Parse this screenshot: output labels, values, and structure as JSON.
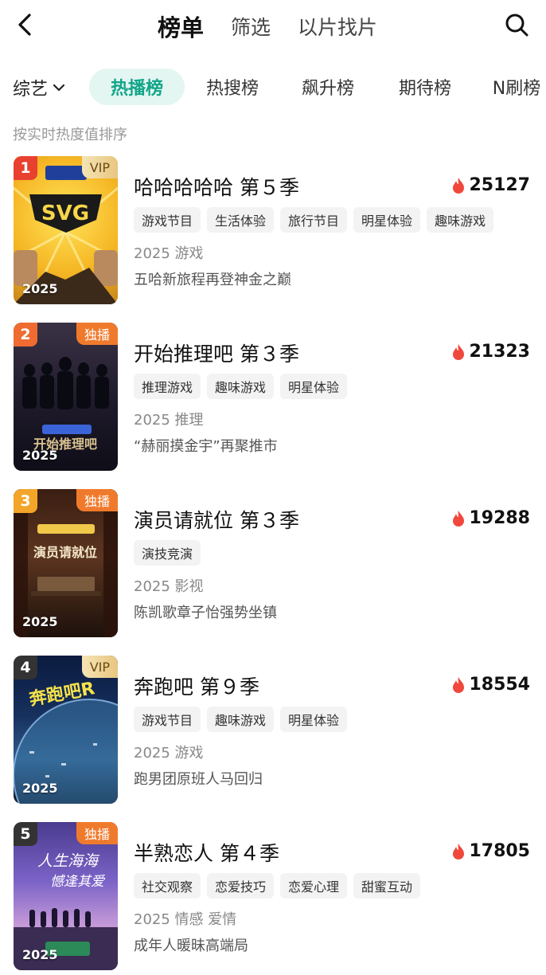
{
  "header": {
    "tabs": [
      "榜单",
      "筛选",
      "以片找片"
    ],
    "active_tab": "榜单"
  },
  "filter": {
    "category": "综艺",
    "chips": [
      "热播榜",
      "热搜榜",
      "飙升榜",
      "期待榜",
      "N刷榜"
    ],
    "active_chip": "热播榜"
  },
  "sort_hint": "按实时热度值排序",
  "items": [
    {
      "rank": "1",
      "badge": "VIP",
      "year_overlay": "2025",
      "title": "哈哈哈哈哈 第５季",
      "heat": "25127",
      "tags": [
        "游戏节目",
        "生活体验",
        "旅行节目",
        "明星体验",
        "趣味游戏"
      ],
      "meta": "2025 游戏",
      "desc": "五哈新旅程再登神金之巅"
    },
    {
      "rank": "2",
      "badge": "独播",
      "year_overlay": "2025",
      "title": "开始推理吧 第３季",
      "heat": "21323",
      "tags": [
        "推理游戏",
        "趣味游戏",
        "明星体验"
      ],
      "meta": "2025 推理",
      "desc": "“赫丽摸金宇”再聚推市"
    },
    {
      "rank": "3",
      "badge": "独播",
      "year_overlay": "2025",
      "title": "演员请就位 第３季",
      "heat": "19288",
      "tags": [
        "演技竞演"
      ],
      "meta": "2025 影视",
      "desc": "陈凯歌章子怡强势坐镇"
    },
    {
      "rank": "4",
      "badge": "VIP",
      "year_overlay": "2025",
      "title": "奔跑吧 第９季",
      "heat": "18554",
      "tags": [
        "游戏节目",
        "趣味游戏",
        "明星体验"
      ],
      "meta": "2025 游戏",
      "desc": "跑男团原班人马回归"
    },
    {
      "rank": "5",
      "badge": "独播",
      "year_overlay": "2025",
      "title": "半熟恋人 第４季",
      "heat": "17805",
      "tags": [
        "社交观察",
        "恋爱技巧",
        "恋爱心理",
        "甜蜜互动"
      ],
      "meta": "2025 情感 爱情",
      "desc": "成年人暖昧高端局"
    }
  ],
  "colors": {
    "accent": "#13a589",
    "accent_bg": "#e4f6f2",
    "heat_icon": "#f0483c",
    "rank_1": "#e8412f",
    "rank_2": "#ef6b31",
    "rank_3": "#f3a529",
    "rank_other": "#333333"
  }
}
